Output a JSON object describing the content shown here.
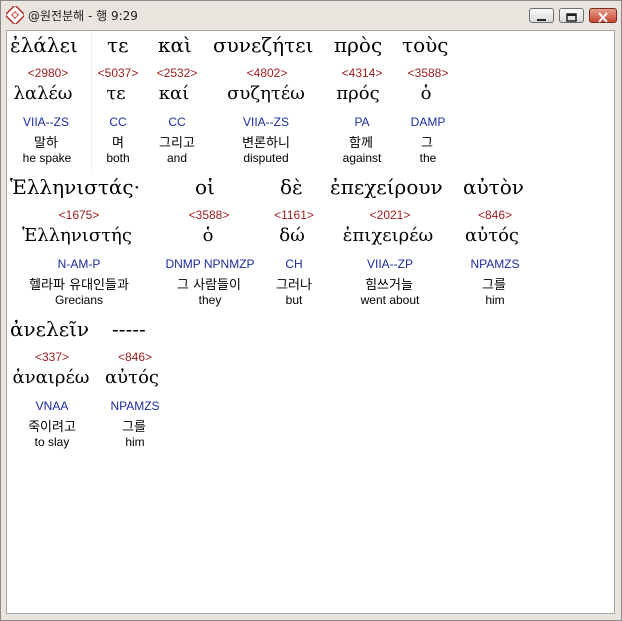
{
  "window": {
    "title": "@원전분해 - 행 9:29"
  },
  "lines": [
    {
      "words": [
        {
          "greek": "ἐλάλει",
          "strong": "<2980>",
          "lemma": "λαλέω",
          "parsing": "VIIA--ZS",
          "korean": "말하",
          "english": "he spake"
        },
        {
          "greek": "τε",
          "strong": "<5037>",
          "lemma": "τε",
          "parsing": "CC",
          "korean": "며",
          "english": "both"
        },
        {
          "greek": "καὶ",
          "strong": "<2532>",
          "lemma": "καί",
          "parsing": "CC",
          "korean": "그리고",
          "english": "and"
        },
        {
          "greek": "συνεζήτει",
          "strong": "<4802>",
          "lemma": "συζητέω",
          "parsing": "VIIA--ZS",
          "korean": "변론하니",
          "english": "disputed"
        },
        {
          "greek": "πρὸς",
          "strong": "<4314>",
          "lemma": "πρός",
          "parsing": "PA",
          "korean": "함께",
          "english": "against"
        },
        {
          "greek": "τοὺς",
          "strong": "<3588>",
          "lemma": "ὁ",
          "parsing": "DAMP",
          "korean": "그",
          "english": "the"
        }
      ]
    },
    {
      "words": [
        {
          "greek": "Ἑλληνιστάς·",
          "strong": "<1675>",
          "lemma": "Ἑλληνιστής",
          "parsing": "N-AM-P",
          "korean": "헬라파 유대인들과",
          "english": "Grecians"
        },
        {
          "greek": "οἱ",
          "strong": "<3588>",
          "lemma": "ὁ",
          "parsing": "DNMP NPNMZP",
          "korean": "그 사람들이",
          "english": "they"
        },
        {
          "greek": "δὲ",
          "strong": "<1161>",
          "lemma": "δώ",
          "parsing": "CH",
          "korean": "그러나",
          "english": "but"
        },
        {
          "greek": "ἐπεχείρουν",
          "strong": "<2021>",
          "lemma": "ἐπιχειρέω",
          "parsing": "VIIA--ZP",
          "korean": "힘쓰거늘",
          "english": "went about"
        },
        {
          "greek": "αὐτὸν",
          "strong": "<846>",
          "lemma": "αὐτός",
          "parsing": "NPAMZS",
          "korean": "그를",
          "english": "him"
        }
      ]
    },
    {
      "words": [
        {
          "greek": "ἀνελεῖν",
          "strong": "<337>",
          "lemma": "ἀναιρέω",
          "parsing": "VNAA",
          "korean": "죽이려고",
          "english": "to slay"
        },
        {
          "greek": "-----",
          "strong": "<846>",
          "lemma": "αὐτός",
          "parsing": "NPAMZS",
          "korean": "그를",
          "english": "him"
        }
      ]
    }
  ]
}
